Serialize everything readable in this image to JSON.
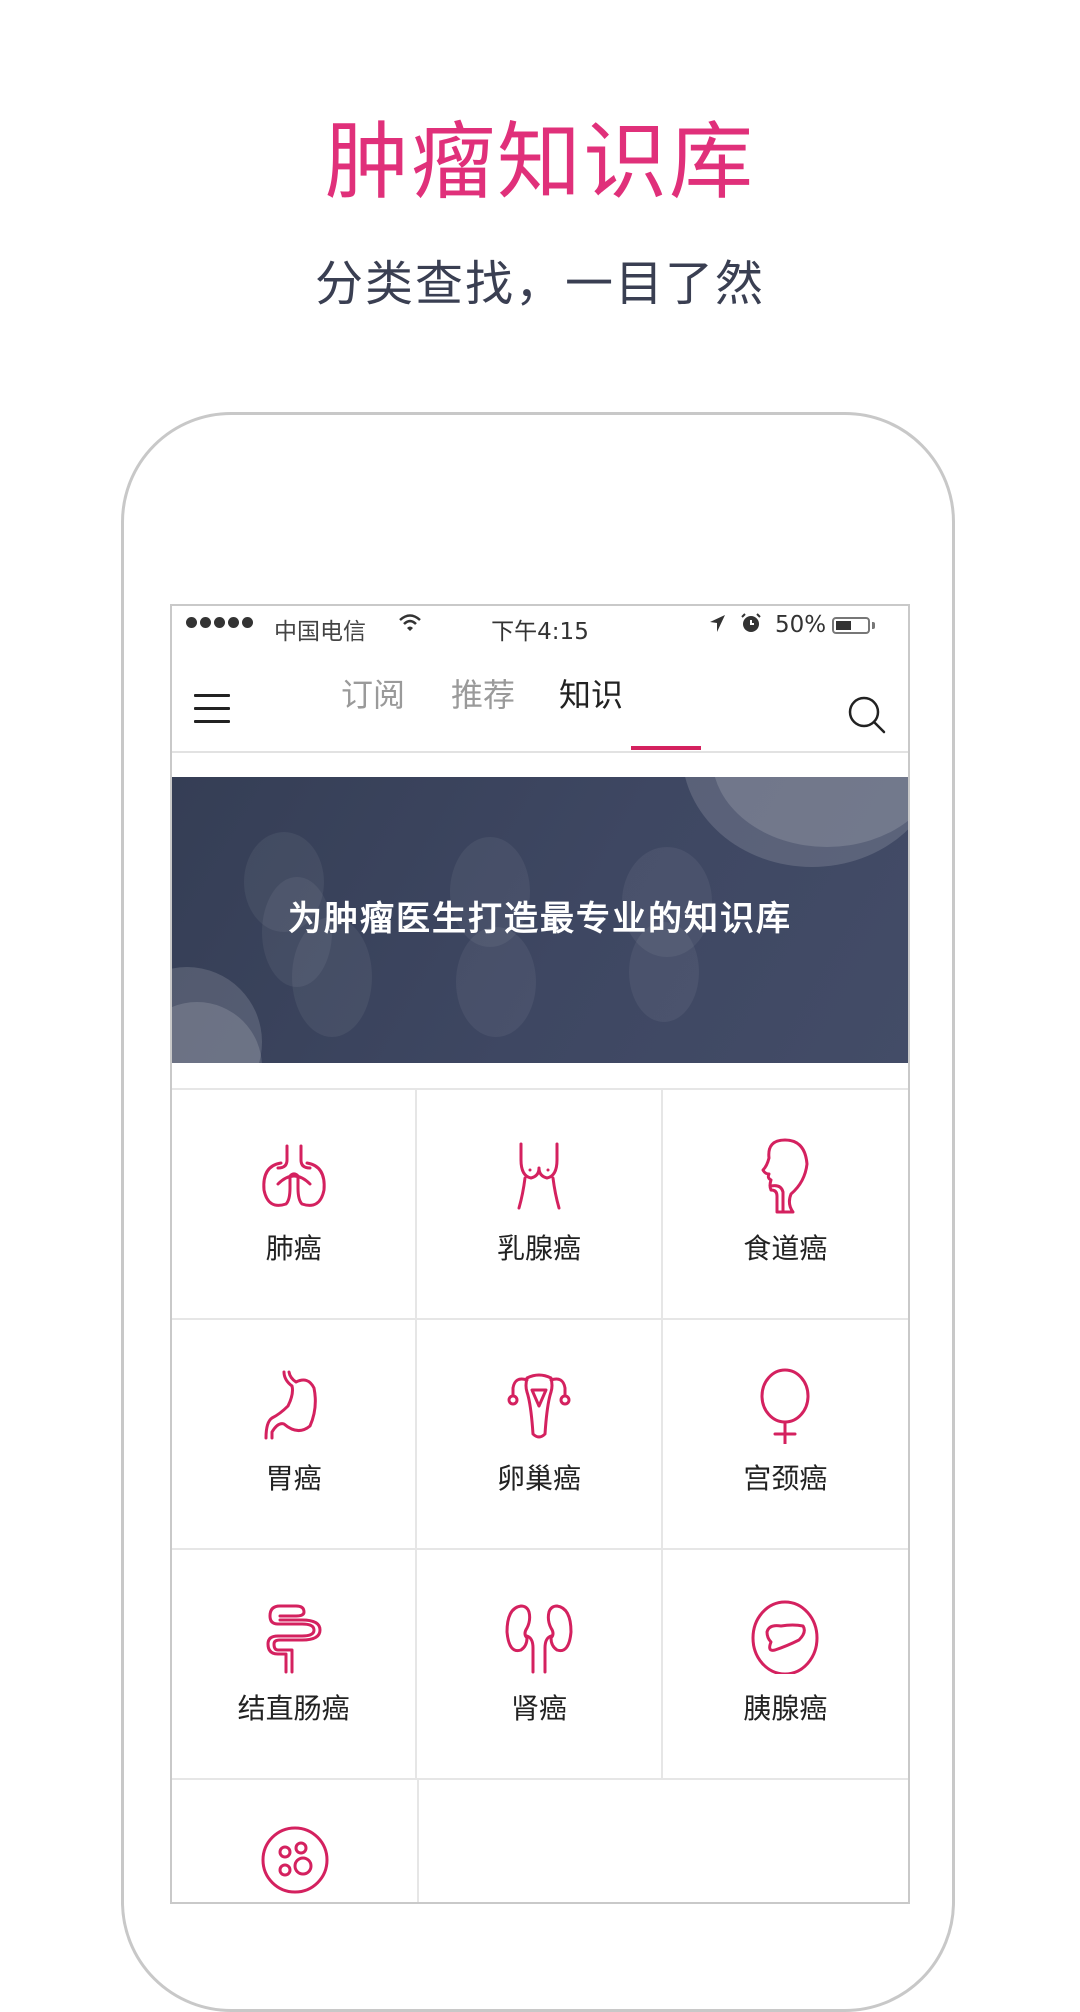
{
  "promo": {
    "title": "肿瘤知识库",
    "subtitle": "分类查找，一目了然"
  },
  "status_bar": {
    "carrier": "中国电信",
    "time": "下午4:15",
    "battery_percent": "50%",
    "battery_level": 0.5
  },
  "nav": {
    "tabs": [
      {
        "label": "订阅",
        "active": false
      },
      {
        "label": "推荐",
        "active": false
      },
      {
        "label": "知识",
        "active": true
      }
    ],
    "menu_icon": "hamburger-menu-icon",
    "search_icon": "search-icon"
  },
  "banner": {
    "text": "为肿瘤医生打造最专业的知识库"
  },
  "categories": [
    {
      "label": "肺癌",
      "icon": "lungs-icon"
    },
    {
      "label": "乳腺癌",
      "icon": "breast-icon"
    },
    {
      "label": "食道癌",
      "icon": "head-throat-icon"
    },
    {
      "label": "胃癌",
      "icon": "stomach-icon"
    },
    {
      "label": "卵巢癌",
      "icon": "uterus-ovary-icon"
    },
    {
      "label": "宫颈癌",
      "icon": "female-symbol-icon"
    },
    {
      "label": "结直肠癌",
      "icon": "intestine-icon"
    },
    {
      "label": "肾癌",
      "icon": "kidneys-icon"
    },
    {
      "label": "胰腺癌",
      "icon": "pancreas-icon"
    },
    {
      "label": "",
      "icon": "cell-icon"
    }
  ],
  "colors": {
    "brand_pink": "#E0307A",
    "icon_pink": "#D4215F",
    "banner_bg": "#3E4762",
    "subtitle": "#3A3F52"
  }
}
